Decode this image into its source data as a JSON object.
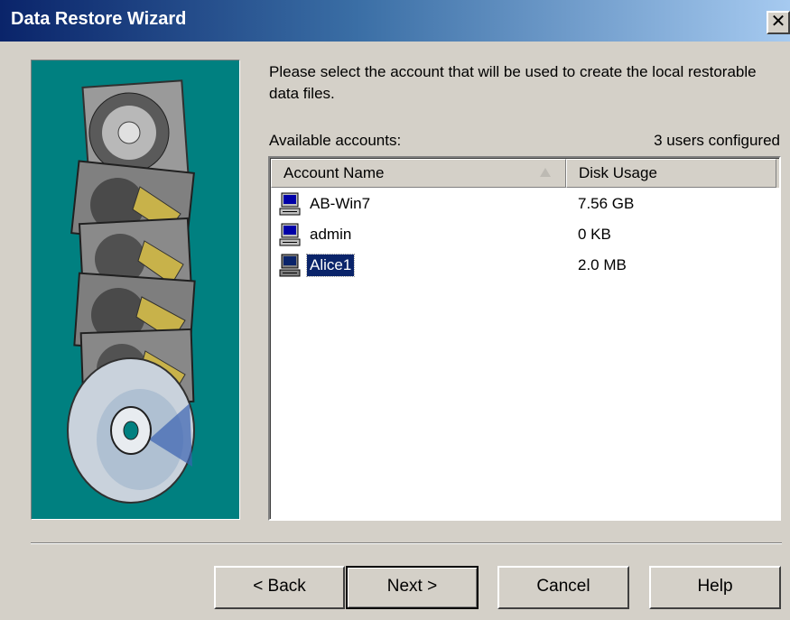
{
  "window": {
    "title": "Data Restore Wizard",
    "close_glyph": "✕"
  },
  "content": {
    "instruction": "Please select the account that will be used to create the local restorable data files.",
    "available_label": "Available accounts:",
    "users_count": "3 users configured"
  },
  "list": {
    "columns": [
      "Account Name",
      "Disk Usage"
    ],
    "sorted_column": "Account Name",
    "rows": [
      {
        "name": "AB-Win7",
        "disk": "7.56 GB",
        "selected": false,
        "icon": "computer-icon"
      },
      {
        "name": "admin",
        "disk": "0 KB",
        "selected": false,
        "icon": "computer-icon"
      },
      {
        "name": "Alice1",
        "disk": "2.0 MB",
        "selected": true,
        "icon": "computer-icon"
      }
    ]
  },
  "buttons": {
    "back": "< Back",
    "next": "Next >",
    "cancel": "Cancel",
    "help": "Help",
    "default": "next"
  },
  "art": {
    "icon": "hard-drives-and-disc-illustration",
    "background": "#008080"
  },
  "colors": {
    "titlebar_start": "#0a246a",
    "titlebar_end": "#a6caf0",
    "dialog_bg": "#d4d0c8",
    "selection": "#0a246a"
  }
}
